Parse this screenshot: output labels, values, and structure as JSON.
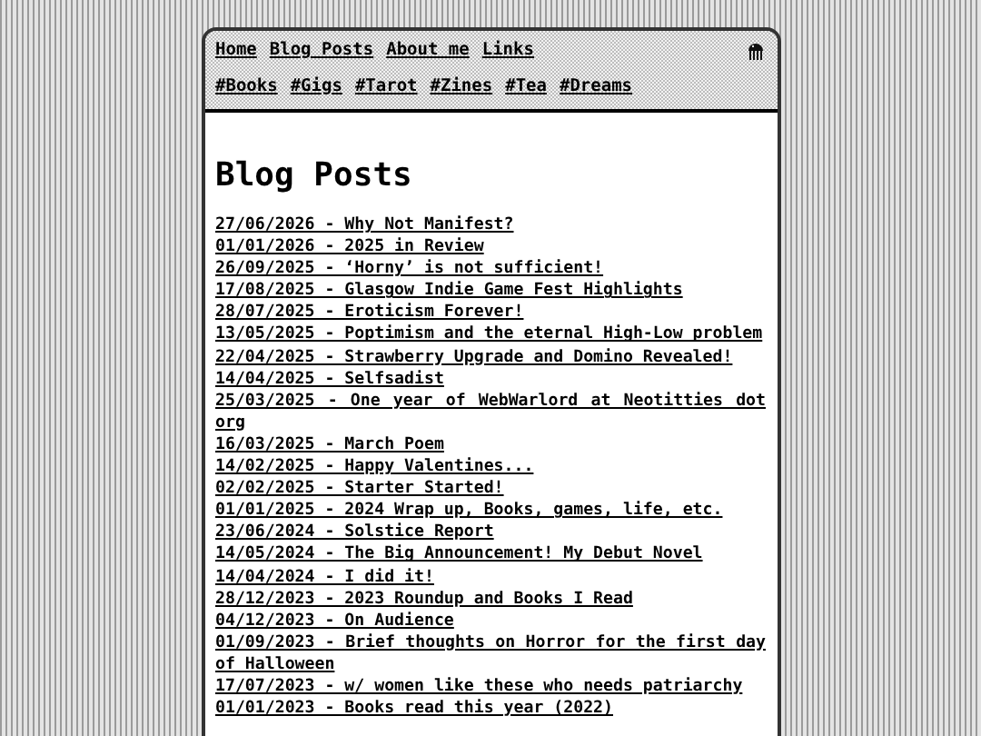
{
  "nav": {
    "links": [
      "Home",
      "Blog Posts",
      "About me",
      "Links"
    ],
    "tags": [
      "#Books",
      "#Gigs",
      "#Tarot",
      "#Zines",
      "#Tea",
      "#Dreams"
    ]
  },
  "page": {
    "title": "Blog Posts",
    "posts": [
      "27/06/2026 - Why Not Manifest?",
      "01/01/2026 - 2025 in Review",
      "26/09/2025 - ‘Horny’ is not sufficient!",
      "17/08/2025 - Glasgow Indie Game Fest Highlights",
      "28/07/2025 - Eroticism Forever!",
      "13/05/2025 - Poptimism and the eternal High-Low problem",
      "22/04/2025 - Strawberry Upgrade and Domino Revealed!",
      "14/04/2025 - Selfsadist",
      "25/03/2025 - One year of WebWarlord at Neotitties dot org",
      "16/03/2025 - March Poem",
      "14/02/2025 - Happy Valentines...",
      "02/02/2025 - Starter Started!",
      "01/01/2025 - 2024 Wrap up, Books, games, life, etc.",
      "23/06/2024 - Solstice Report",
      "14/05/2024 - The Big Announcement! My Debut Novel",
      "14/04/2024 - I did it!",
      "28/12/2023 - 2023 Roundup and Books I Read",
      "04/12/2023 - On Audience",
      "01/09/2023 - Brief thoughts on Horror for the first day of Halloween",
      "17/07/2023 - w/ women like these who needs patriarchy",
      "01/01/2023 - Books read this year (2022)"
    ]
  }
}
